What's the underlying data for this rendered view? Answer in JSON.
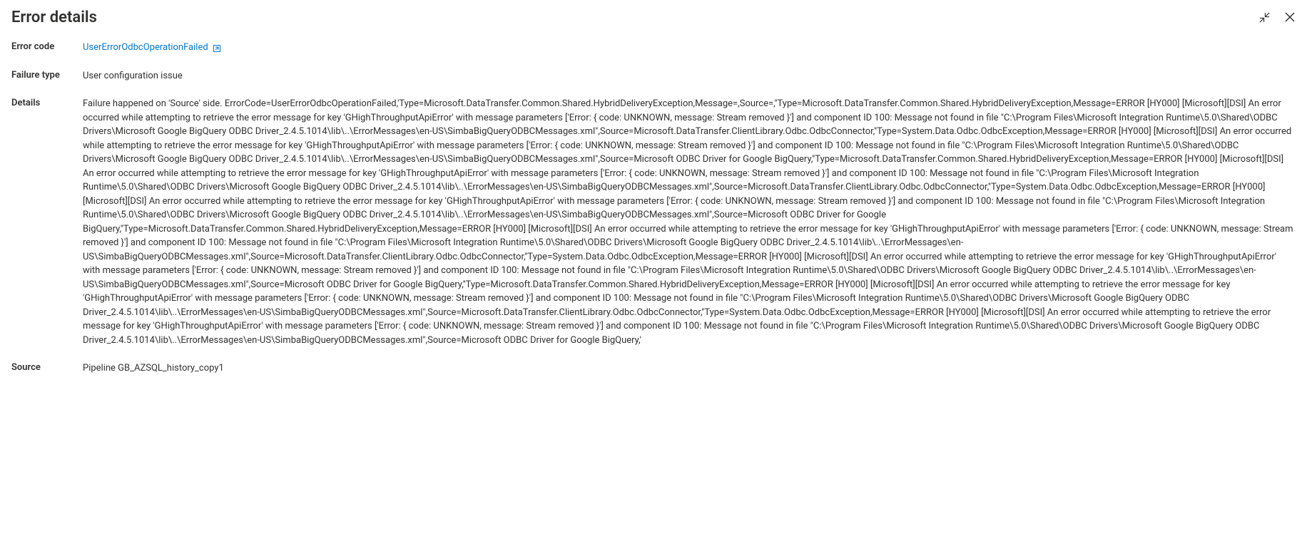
{
  "header": {
    "title": "Error details"
  },
  "fields": {
    "errorCode": {
      "label": "Error code",
      "value": "UserErrorOdbcOperationFailed"
    },
    "failureType": {
      "label": "Failure type",
      "value": "User configuration issue"
    },
    "details": {
      "label": "Details",
      "value": "Failure happened on 'Source' side.\nErrorCode=UserErrorOdbcOperationFailed,'Type=Microsoft.DataTransfer.Common.Shared.HybridDeliveryException,Message=,Source=,''Type=Microsoft.DataTransfer.Common.Shared.HybridDeliveryException,Message=ERROR [HY000] [Microsoft][DSI] An error occurred while attempting to retrieve the error message for key 'GHighThroughputApiError' with message parameters ['Error: { code: UNKNOWN, message: Stream removed }'] and component ID 100: Message not found in file \"C:\\Program Files\\Microsoft Integration Runtime\\5.0\\Shared\\ODBC Drivers\\Microsoft Google BigQuery ODBC Driver_2.4.5.1014\\lib\\..\\ErrorMessages\\en-US\\SimbaBigQueryODBCMessages.xml\",Source=Microsoft.DataTransfer.ClientLibrary.Odbc.OdbcConnector,''Type=System.Data.Odbc.OdbcException,Message=ERROR [HY000] [Microsoft][DSI] An error occurred while attempting to retrieve the error message for key 'GHighThroughputApiError' with message parameters ['Error: { code: UNKNOWN, message: Stream removed }'] and component ID 100: Message not found in file \"C:\\Program Files\\Microsoft Integration Runtime\\5.0\\Shared\\ODBC Drivers\\Microsoft Google BigQuery ODBC Driver_2.4.5.1014\\lib\\..\\ErrorMessages\\en-US\\SimbaBigQueryODBCMessages.xml\",Source=Microsoft ODBC Driver for Google BigQuery,''Type=Microsoft.DataTransfer.Common.Shared.HybridDeliveryException,Message=ERROR [HY000] [Microsoft][DSI] An error occurred while attempting to retrieve the error message for key 'GHighThroughputApiError' with message parameters ['Error: { code: UNKNOWN, message: Stream removed }'] and component ID 100: Message not found in file \"C:\\Program Files\\Microsoft Integration Runtime\\5.0\\Shared\\ODBC Drivers\\Microsoft Google BigQuery ODBC Driver_2.4.5.1014\\lib\\..\\ErrorMessages\\en-US\\SimbaBigQueryODBCMessages.xml\",Source=Microsoft.DataTransfer.ClientLibrary.Odbc.OdbcConnector,''Type=System.Data.Odbc.OdbcException,Message=ERROR [HY000] [Microsoft][DSI] An error occurred while attempting to retrieve the error message for key 'GHighThroughputApiError' with message parameters ['Error: { code: UNKNOWN, message: Stream removed }'] and component ID 100: Message not found in file \"C:\\Program Files\\Microsoft Integration Runtime\\5.0\\Shared\\ODBC Drivers\\Microsoft Google BigQuery ODBC Driver_2.4.5.1014\\lib\\..\\ErrorMessages\\en-US\\SimbaBigQueryODBCMessages.xml\",Source=Microsoft ODBC Driver for Google BigQuery,''Type=Microsoft.DataTransfer.Common.Shared.HybridDeliveryException,Message=ERROR [HY000] [Microsoft][DSI] An error occurred while attempting to retrieve the error message for key 'GHighThroughputApiError' with message parameters ['Error: { code: UNKNOWN, message: Stream removed }'] and component ID 100: Message not found in file \"C:\\Program Files\\Microsoft Integration Runtime\\5.0\\Shared\\ODBC Drivers\\Microsoft Google BigQuery ODBC Driver_2.4.5.1014\\lib\\..\\ErrorMessages\\en-US\\SimbaBigQueryODBCMessages.xml\",Source=Microsoft.DataTransfer.ClientLibrary.Odbc.OdbcConnector,''Type=System.Data.Odbc.OdbcException,Message=ERROR [HY000] [Microsoft][DSI] An error occurred while attempting to retrieve the error message for key 'GHighThroughputApiError' with message parameters ['Error: { code: UNKNOWN, message: Stream removed }'] and component ID 100: Message not found in file \"C:\\Program Files\\Microsoft Integration Runtime\\5.0\\Shared\\ODBC Drivers\\Microsoft Google BigQuery ODBC Driver_2.4.5.1014\\lib\\..\\ErrorMessages\\en-US\\SimbaBigQueryODBCMessages.xml\",Source=Microsoft ODBC Driver for Google BigQuery,''Type=Microsoft.DataTransfer.Common.Shared.HybridDeliveryException,Message=ERROR [HY000] [Microsoft][DSI] An error occurred while attempting to retrieve the error message for key 'GHighThroughputApiError' with message parameters ['Error: { code: UNKNOWN, message: Stream removed }'] and component ID 100: Message not found in file \"C:\\Program Files\\Microsoft Integration Runtime\\5.0\\Shared\\ODBC Drivers\\Microsoft Google BigQuery ODBC Driver_2.4.5.1014\\lib\\..\\ErrorMessages\\en-US\\SimbaBigQueryODBCMessages.xml\",Source=Microsoft.DataTransfer.ClientLibrary.Odbc.OdbcConnector,''Type=System.Data.Odbc.OdbcException,Message=ERROR [HY000] [Microsoft][DSI] An error occurred while attempting to retrieve the error message for key 'GHighThroughputApiError' with message parameters ['Error: { code: UNKNOWN, message: Stream removed }'] and component ID 100: Message not found in file \"C:\\Program Files\\Microsoft Integration Runtime\\5.0\\Shared\\ODBC Drivers\\Microsoft Google BigQuery ODBC Driver_2.4.5.1014\\lib\\..\\ErrorMessages\\en-US\\SimbaBigQueryODBCMessages.xml\",Source=Microsoft ODBC Driver for Google BigQuery,'"
    },
    "source": {
      "label": "Source",
      "value": "Pipeline GB_AZSQL_history_copy1"
    }
  }
}
